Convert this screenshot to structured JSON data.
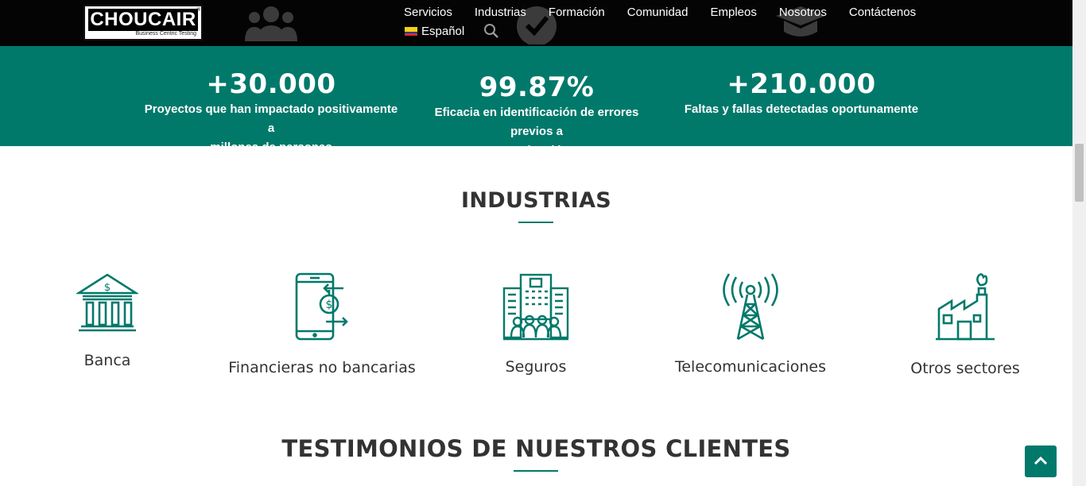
{
  "header": {
    "logo_text": "CHOUCAIR",
    "logo_tagline": "Business Centric Testing",
    "nav": [
      "Servicios",
      "Industrias",
      "Formación",
      "Comunidad",
      "Empleos",
      "Nosotros",
      "Contáctenos"
    ],
    "language": "Español"
  },
  "stats": [
    {
      "value": "+30.000",
      "label_line1": "Proyectos que han impactado positivamente a",
      "label_line2": "millones de personas"
    },
    {
      "value": "99.87%",
      "label_line1": "Eficacia en identificación de errores previos a",
      "label_line2": "producción"
    },
    {
      "value": "+210.000",
      "label_line1": "Faltas y fallas detectadas oportunamente",
      "label_line2": ""
    }
  ],
  "industries": {
    "title": "INDUSTRIAS",
    "items": [
      {
        "label": "Banca",
        "icon": "bank-icon"
      },
      {
        "label": "Financieras no bancarias",
        "icon": "mobile-payment-icon"
      },
      {
        "label": "Seguros",
        "icon": "insurance-building-icon"
      },
      {
        "label": "Telecomunicaciones",
        "icon": "antenna-tower-icon"
      },
      {
        "label": "Otros sectores",
        "icon": "factory-icon"
      }
    ]
  },
  "testimonials": {
    "title": "TESTIMONIOS DE NUESTROS CLIENTES"
  },
  "colors": {
    "brand_green": "#00796b",
    "header_bg": "#040404"
  }
}
